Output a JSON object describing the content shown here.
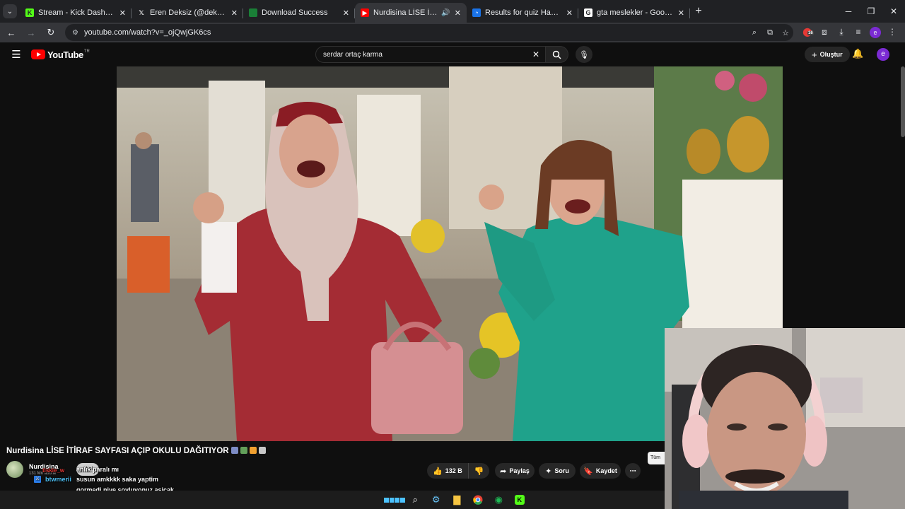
{
  "browser": {
    "tabs": [
      {
        "title": "Stream - Kick Dashboard",
        "favicon": "kick-icon",
        "color": "#53fc18",
        "glyph": "K",
        "active": false
      },
      {
        "title": "Eren Deksiz (@deksizadam) adl",
        "favicon": "x-icon",
        "color": "#202124",
        "glyph": "𝕏",
        "active": false
      },
      {
        "title": "Download Success",
        "favicon": "download-site-icon",
        "color": "#1a7f37",
        "glyph": "",
        "active": false
      },
      {
        "title": "Nurdisina LİSE İTİRAF SAYFA",
        "favicon": "youtube-icon",
        "color": "#ff0000",
        "glyph": "▶",
        "active": true,
        "audio": "🔊"
      },
      {
        "title": "Results for quiz Hangi Crush Üy",
        "favicon": "quiz-site-icon",
        "color": "#1a73e8",
        "glyph": "◔",
        "active": false
      },
      {
        "title": "gta meslekler - Google'da Ara",
        "favicon": "google-icon",
        "color": "#ffffff",
        "glyph": "G",
        "active": false
      }
    ],
    "new_tab": "+",
    "url": "youtube.com/watch?v=_ojQwjGK6cs",
    "extension_badge": "16",
    "profile_initial": "e"
  },
  "youtube": {
    "logo_text": "YouTube",
    "logo_region": "TR",
    "search_value": "serdar ortaç karma",
    "create_label": "Oluştur",
    "avatar_initial": "e"
  },
  "video": {
    "title": "Nurdisina LİSE İTİRAF SAYFASI AÇIP OKULU DAĞITIYOR",
    "title_emojis": [
      "#7d8cc4",
      "#63a05a",
      "#f0a030",
      "#c7c7c7"
    ],
    "channel_name": "Nurdisina",
    "channel_subs": "131 Mn abone",
    "join_label": "Abol",
    "likes": "132 B",
    "share_label": "Paylaş",
    "ask_label": "Soru",
    "save_label": "Kaydet",
    "more_label": "⋯",
    "side_chip": "Tüm"
  },
  "chat": {
    "line1": "anlık paralı mı",
    "user_red": "tiskie_w",
    "user2": "btwmerii",
    "message": "susun amkkkk saka yaptim gormedi niye soyluyonuz asicak beni",
    "badge": "⚔"
  },
  "taskbar": {
    "icons": [
      "windows-start-icon",
      "search-icon",
      "steam-icon",
      "file-explorer-icon",
      "chrome-icon",
      "spotify-icon",
      "kick-app-icon"
    ]
  }
}
